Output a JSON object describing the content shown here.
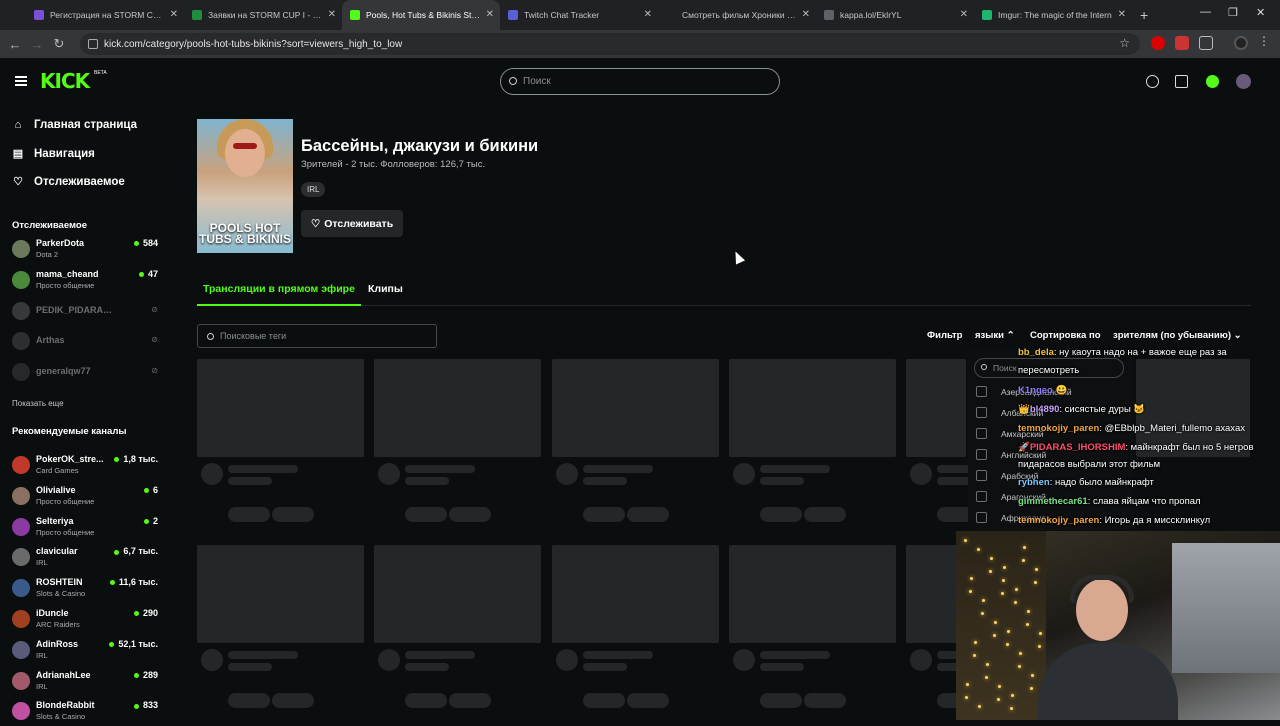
{
  "browser": {
    "tabs": [
      {
        "title": "Регистрация на STORM CUP I",
        "favicon": "form-icon",
        "color": "#7b4fd6"
      },
      {
        "title": "Заявки на STORM CUP I - Goo",
        "favicon": "sheets-icon",
        "color": "#1e8e3e"
      },
      {
        "title": "Pools, Hot Tubs & Bikinis Strea",
        "favicon": "kick-icon",
        "color": "#53fc18",
        "active": true
      },
      {
        "title": "Twitch Chat Tracker",
        "favicon": "tracker-icon",
        "color": "#5b5fd6"
      },
      {
        "title": "Смотреть фильм Хроники Нар",
        "favicon": "hd-icon",
        "color": "#202124"
      },
      {
        "title": "kappa.lol/EklrYL",
        "favicon": "globe-icon",
        "color": "#5f6368"
      },
      {
        "title": "Imgur: The magic of the Intern",
        "favicon": "imgur-icon",
        "color": "#1bb76e"
      }
    ],
    "url": "kick.com/category/pools-hot-tubs-bikinis?sort=viewers_high_to_low"
  },
  "header": {
    "logo": "KICK",
    "beta": "BETA",
    "search_placeholder": "Поиск"
  },
  "sidebar": {
    "nav": [
      {
        "label": "Главная страница",
        "icon": "home-icon"
      },
      {
        "label": "Навигация",
        "icon": "browse-icon"
      },
      {
        "label": "Отслеживаемое",
        "icon": "heart-icon"
      }
    ],
    "following_title": "Отслеживаемое",
    "following": [
      {
        "name": "ParkerDota",
        "sub": "Dota 2",
        "viewers": "584",
        "color": "#6a7a5a"
      },
      {
        "name": "mama_cheand",
        "sub": "Просто общение",
        "viewers": "47",
        "color": "#4a8a3a"
      },
      {
        "name": "PEDIK_PIDARAS_JUG...",
        "offline": true,
        "color": "#555"
      },
      {
        "name": "Arthas",
        "offline": true,
        "color": "#444"
      },
      {
        "name": "generalqw77",
        "offline": true,
        "color": "#3a3a3a"
      }
    ],
    "show_more": "Показать еще",
    "recommended_title": "Рекомендуемые каналы",
    "recommended": [
      {
        "name": "PokerOK_stre...",
        "sub": "Card Games",
        "viewers": "1,8 тыс.",
        "color": "#c0392b"
      },
      {
        "name": "Olivialive",
        "sub": "Просто общение",
        "viewers": "6",
        "color": "#8a7060"
      },
      {
        "name": "Selteriya",
        "sub": "Просто общение",
        "viewers": "2",
        "color": "#8a3aa0"
      },
      {
        "name": "clavicular",
        "sub": "IRL",
        "viewers": "6,7 тыс.",
        "color": "#6a6a6a"
      },
      {
        "name": "ROSHTEIN",
        "sub": "Slots & Casino",
        "viewers": "11,6 тыс.",
        "color": "#3a5a8a"
      },
      {
        "name": "iDuncle",
        "sub": "ARC Raiders",
        "viewers": "290",
        "color": "#a04020"
      },
      {
        "name": "AdinRoss",
        "sub": "IRL",
        "viewers": "52,1 тыс.",
        "color": "#5a5a7a"
      },
      {
        "name": "AdrianahLee",
        "sub": "IRL",
        "viewers": "289",
        "color": "#a05a6a"
      },
      {
        "name": "BlondeRabbit",
        "sub": "Slots & Casino",
        "viewers": "833",
        "color": "#c050a0"
      }
    ]
  },
  "category": {
    "title": "Бассейны, джакузи и бикини",
    "stats": "Зрителей - 2 тыс.   Фолловеров: 126,7 тыс.",
    "tag": "IRL",
    "follow_label": "Отслеживать",
    "thumb_text": "POOLS HOT TUBS & BIKINIS"
  },
  "tabs": {
    "live": "Трансляции в прямом эфире",
    "clips": "Клипы"
  },
  "filters": {
    "tag_search_placeholder": "Поисковые теги",
    "filter_label": "Фильтр",
    "languages_label": "языки",
    "sort_label": "Сортировка по",
    "sort_value": "зрителям (по убыванию)"
  },
  "language_dropdown": {
    "search_placeholder": "Поиск",
    "items": [
      "Азербайджанский",
      "Албанский",
      "Амхарский",
      "Английский",
      "Арабский",
      "Арагонский",
      "Африкаанс"
    ]
  },
  "chat": [
    {
      "user": "bb_dela",
      "text": ": ну каоута надо на + важое еще раз за",
      "color": "#f5c242"
    },
    {
      "user": "",
      "text": "пересмотреть",
      "color": "#ffffff"
    },
    {
      "user": "K1ngeo",
      "text": " 😃",
      "color": "#8e7bff"
    },
    {
      "user": "👑bl4890",
      "text": ": сисястые дуры 🐱",
      "color": "#c8a2ff"
    },
    {
      "user": "temnokojiy_paren",
      "text": ": @EBblpb_Materi_fullemo ахахах",
      "color": "#f5a742"
    },
    {
      "user": "🚀PIDARAS_IHORSHIM",
      "text": ": майнкрафт был но 5 негров",
      "color": "#ff4d6d"
    },
    {
      "user": "",
      "text": "пидарасов выбрали этот фильм",
      "color": "#ffffff"
    },
    {
      "user": "rybhen",
      "text": ": надо было майнкрафт",
      "color": "#7ec8ff"
    },
    {
      "user": "gimmethecar61",
      "text": ": слава яйцам что пропал",
      "color": "#7be08a"
    },
    {
      "user": "temnokojiy_paren",
      "text": ": Игорь да я миссклинкул",
      "color": "#f5a742"
    }
  ],
  "colors": {
    "accent": "#53fc18",
    "background": "#0b0e0f",
    "skeleton": "#24272a"
  }
}
